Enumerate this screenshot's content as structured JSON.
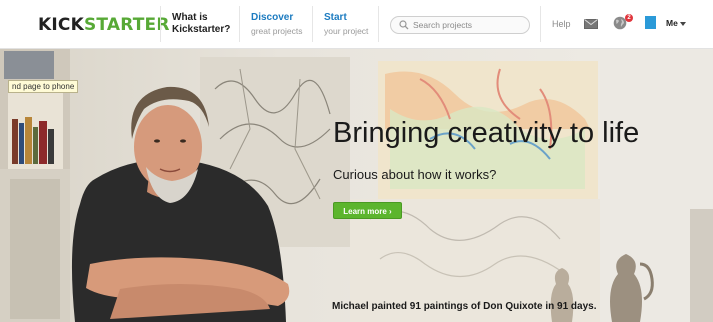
{
  "header": {
    "logo_left": "KICK",
    "logo_right": "STARTER",
    "what_line1": "What is",
    "what_line2": "Kickstarter?",
    "discover_main": "Discover",
    "discover_sub": "great projects",
    "start_main": "Start",
    "start_sub": "your project",
    "search_placeholder": "Search projects",
    "help_label": "Help",
    "notification_count": "2",
    "me_label": "Me",
    "icons": [
      "search-icon",
      "mail-icon",
      "globe-icon",
      "avatar",
      "caret-down-icon"
    ]
  },
  "tooltip": "nd page to phone",
  "hero": {
    "headline": "Bringing creativity to life",
    "subhead": "Curious about how it works?",
    "cta_label": "Learn more ›",
    "caption": "Michael painted 91 paintings of Don Quixote in 91 days."
  },
  "colors": {
    "brand_green": "#57a936",
    "link_blue": "#1c7bc0",
    "cta_green": "#5cb52d",
    "badge_red": "#e0353c"
  }
}
